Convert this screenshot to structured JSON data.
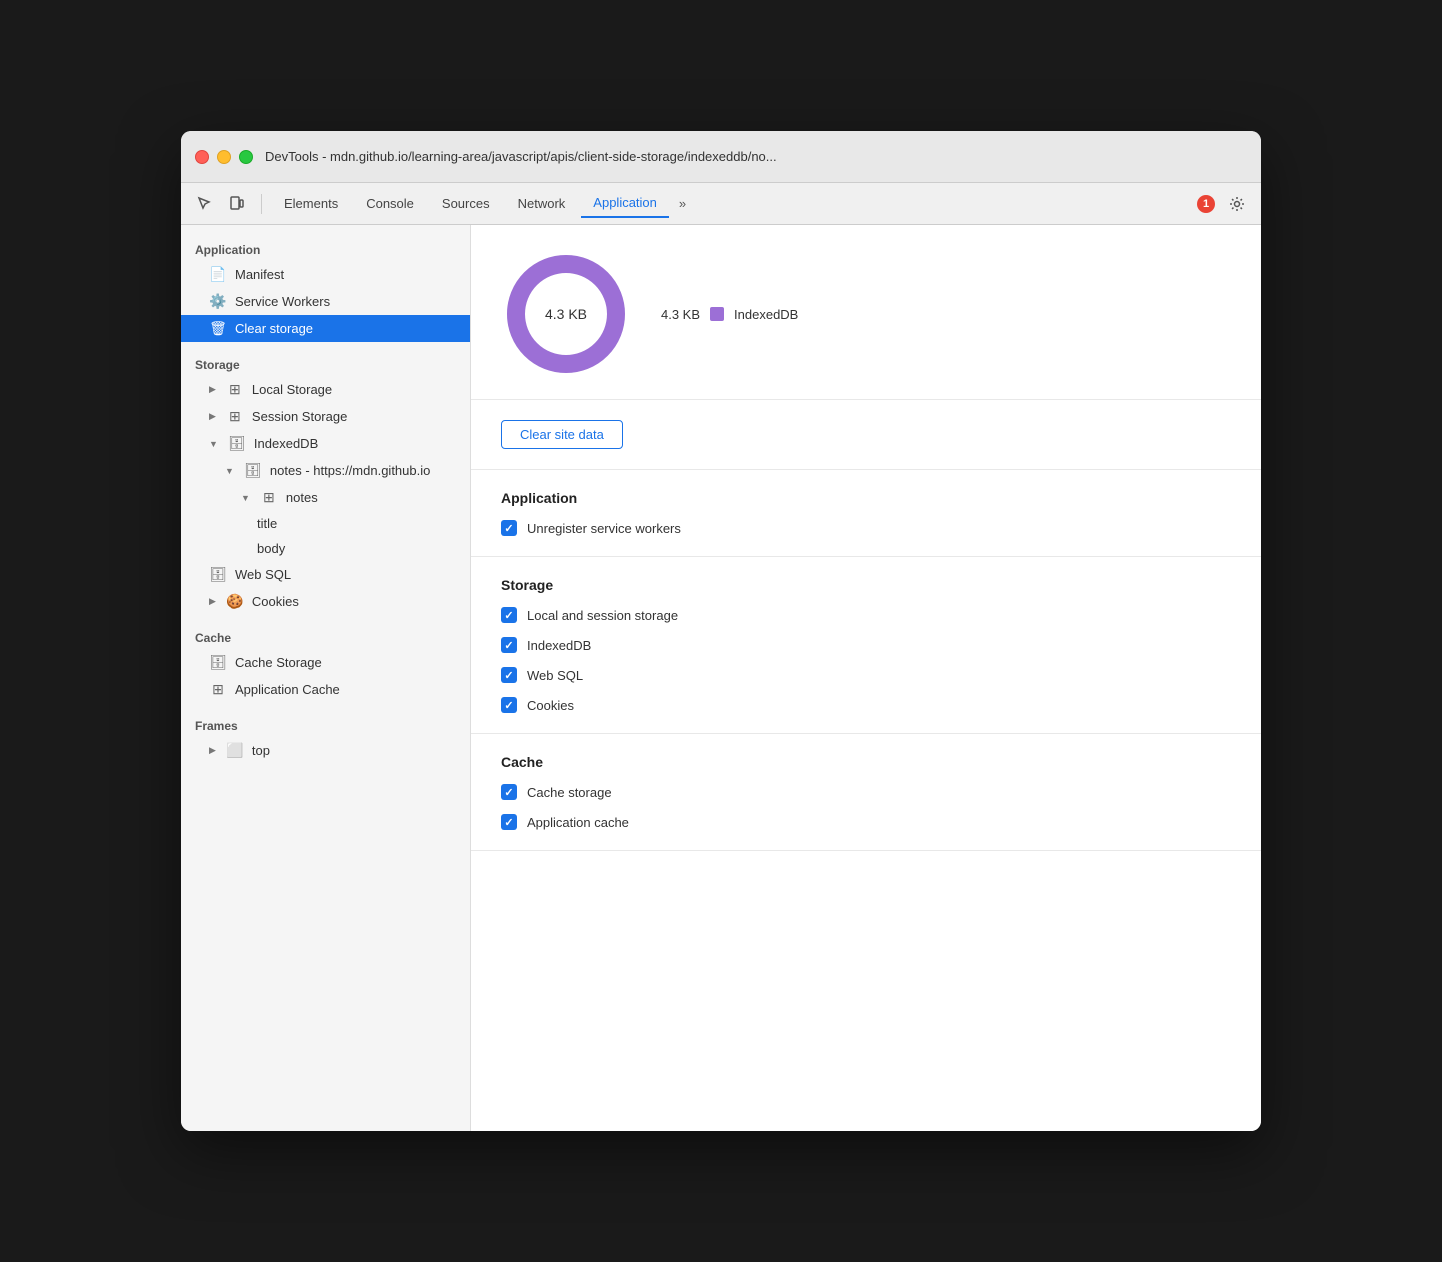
{
  "window": {
    "title": "DevTools - mdn.github.io/learning-area/javascript/apis/client-side-storage/indexeddb/no...",
    "error_count": "1"
  },
  "toolbar": {
    "tabs": [
      {
        "label": "Elements",
        "active": false
      },
      {
        "label": "Console",
        "active": false
      },
      {
        "label": "Sources",
        "active": false
      },
      {
        "label": "Network",
        "active": false
      },
      {
        "label": "Application",
        "active": true
      }
    ],
    "more_label": "»"
  },
  "sidebar": {
    "application_label": "Application",
    "manifest_label": "Manifest",
    "service_workers_label": "Service Workers",
    "clear_storage_label": "Clear storage",
    "storage_label": "Storage",
    "local_storage_label": "Local Storage",
    "session_storage_label": "Session Storage",
    "indexeddb_label": "IndexedDB",
    "notes_db_label": "notes - https://mdn.github.io",
    "notes_store_label": "notes",
    "title_label": "title",
    "body_label": "body",
    "websql_label": "Web SQL",
    "cookies_label": "Cookies",
    "cache_label": "Cache",
    "cache_storage_label": "Cache Storage",
    "app_cache_label": "Application Cache",
    "frames_label": "Frames",
    "top_label": "top"
  },
  "chart": {
    "center_label": "4.3 KB",
    "legend_value": "4.3 KB",
    "legend_label": "IndexedDB",
    "legend_color": "#9c6fd6"
  },
  "clear_btn_label": "Clear site data",
  "application_section": {
    "title": "Application",
    "items": [
      {
        "label": "Unregister service workers",
        "checked": true
      }
    ]
  },
  "storage_section": {
    "title": "Storage",
    "items": [
      {
        "label": "Local and session storage",
        "checked": true
      },
      {
        "label": "IndexedDB",
        "checked": true
      },
      {
        "label": "Web SQL",
        "checked": true
      },
      {
        "label": "Cookies",
        "checked": true
      }
    ]
  },
  "cache_section": {
    "title": "Cache",
    "items": [
      {
        "label": "Cache storage",
        "checked": true
      },
      {
        "label": "Application cache",
        "checked": true
      }
    ]
  }
}
